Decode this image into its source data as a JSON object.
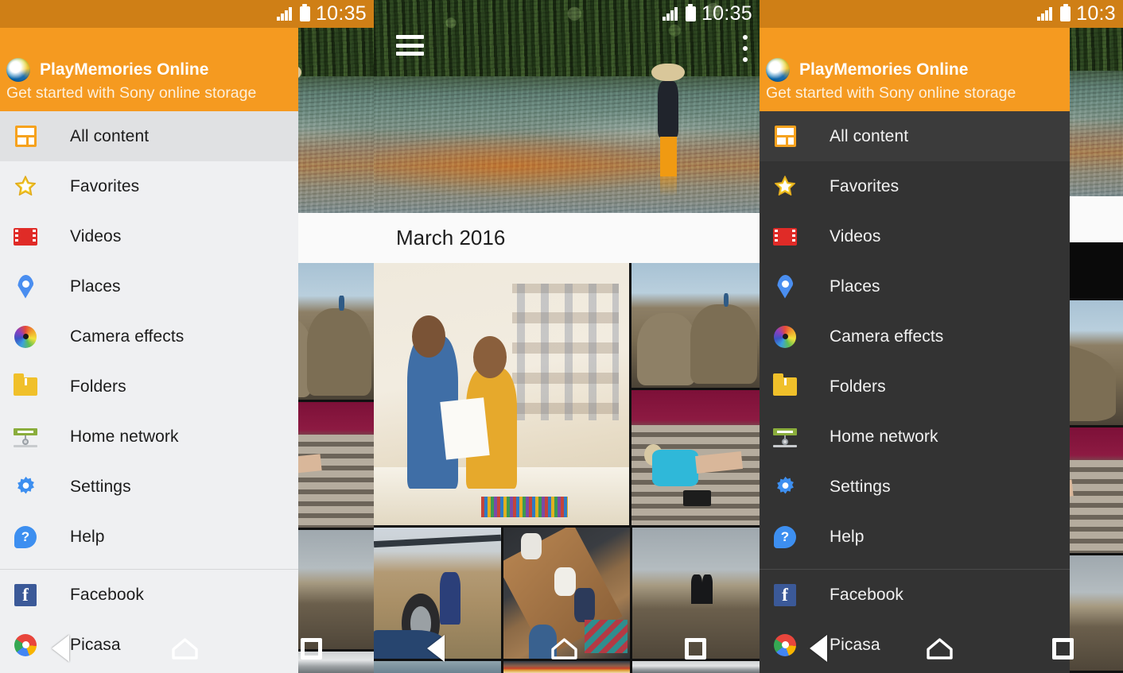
{
  "app": {
    "name": "PlayMemories Online",
    "tagline": "Get started with Sony online storage",
    "logo_icon": "playmemories-logo-icon",
    "header_color": "#f59a20",
    "statusbar_color": "#cf7f16",
    "drawer_light_bg": "#eff0f2",
    "drawer_dark_bg": "#333333"
  },
  "status_bar": {
    "time_left": "10:35",
    "time_mid": "10:35",
    "time_right": "10:3",
    "signal_icon": "signal-bars-icon",
    "battery_icon": "battery-icon"
  },
  "drawer": {
    "items": [
      {
        "label": "All content",
        "icon": "all-content-icon",
        "active": true
      },
      {
        "label": "Favorites",
        "icon": "star-icon",
        "active": false
      },
      {
        "label": "Videos",
        "icon": "film-strip-icon",
        "active": false
      },
      {
        "label": "Places",
        "icon": "map-pin-icon",
        "active": false
      },
      {
        "label": "Camera effects",
        "icon": "color-wheel-icon",
        "active": false
      },
      {
        "label": "Folders",
        "icon": "folder-icon",
        "active": false
      },
      {
        "label": "Home network",
        "icon": "home-network-icon",
        "active": false
      },
      {
        "label": "Settings",
        "icon": "gear-icon",
        "active": false
      },
      {
        "label": "Help",
        "icon": "question-bubble-icon",
        "active": false
      }
    ],
    "services": [
      {
        "label": "Facebook",
        "icon": "facebook-icon"
      },
      {
        "label": "Picasa",
        "icon": "picasa-icon"
      }
    ]
  },
  "content": {
    "month_header": "March 2016",
    "menu_icon": "hamburger-menu-icon",
    "overflow_icon": "overflow-menu-icon",
    "hero_photo": "man-standing-in-river-photo",
    "photos": [
      "two-people-laughing-in-office-photo",
      "person-sitting-on-rocks-photo",
      "woman-lying-on-stairs-photo",
      "jeep-tire-on-dirt-road-photo",
      "people-around-wooden-table-photo",
      "couple-walking-in-field-photo",
      "boat-on-water-photo",
      "flowers-on-table-photo",
      "white-wall-photo"
    ]
  },
  "navigation_bar": {
    "back": "back-nav-icon",
    "home": "home-nav-icon",
    "recents": "recents-nav-icon"
  }
}
